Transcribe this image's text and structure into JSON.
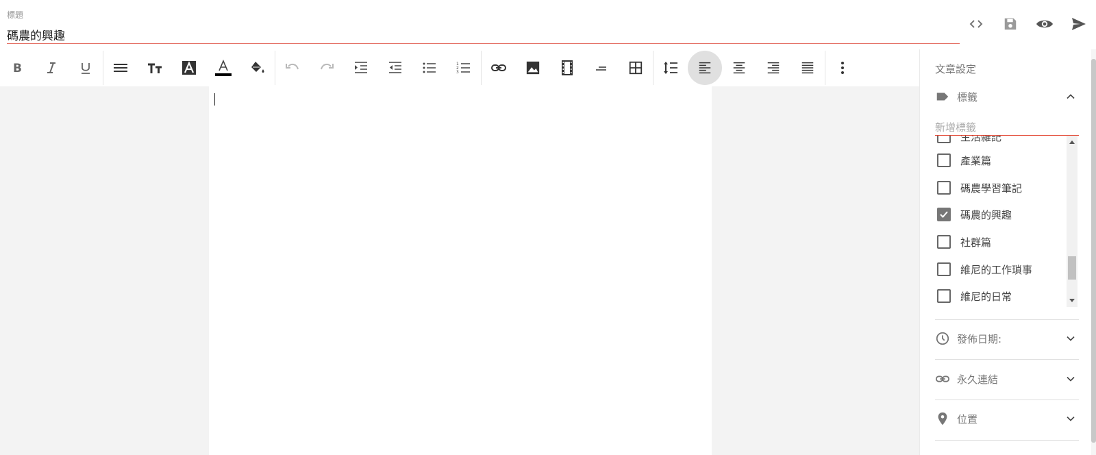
{
  "title": {
    "label": "標題",
    "value": "碼農的興趣"
  },
  "top_actions": [
    {
      "name": "code-view-icon"
    },
    {
      "name": "save-icon"
    },
    {
      "name": "preview-icon"
    },
    {
      "name": "publish-send-icon"
    }
  ],
  "toolbar": {
    "groups": [
      [
        "bold-icon",
        "italic-icon",
        "underline-icon"
      ],
      [
        "paragraph-icon",
        "font-size-icon",
        "text-style-icon",
        "text-color-icon",
        "fill-color-icon"
      ],
      [
        "undo-icon",
        "redo-icon",
        "indent-icon",
        "outdent-icon",
        "bullet-list-icon",
        "numbered-list-icon"
      ],
      [
        "link-icon",
        "image-icon",
        "video-icon",
        "horizontal-rule-icon",
        "table-icon"
      ],
      [
        "line-height-icon",
        "align-left-icon",
        "align-center-icon",
        "align-right-icon",
        "align-justify-icon"
      ],
      [
        "more-vert-icon"
      ]
    ],
    "active": "align-left-icon",
    "disabled": [
      "undo-icon",
      "redo-icon"
    ],
    "text_color": "#000000"
  },
  "panel": {
    "title": "文章設定",
    "tags_section": {
      "label": "標籤",
      "input_placeholder": "新增標籤",
      "items": [
        {
          "label": "生活雜記",
          "checked": false
        },
        {
          "label": "產業篇",
          "checked": false
        },
        {
          "label": "碼農學習筆記",
          "checked": false
        },
        {
          "label": "碼農的興趣",
          "checked": true
        },
        {
          "label": "社群篇",
          "checked": false
        },
        {
          "label": "維尼的工作瑣事",
          "checked": false
        },
        {
          "label": "維尼的日常",
          "checked": false
        }
      ]
    },
    "publish_date": {
      "label": "發佈日期:"
    },
    "permalink": {
      "label": "永久連結"
    },
    "location": {
      "label": "位置"
    }
  },
  "colors": {
    "accent_underline": "#e2432f",
    "icon": "#555555"
  }
}
